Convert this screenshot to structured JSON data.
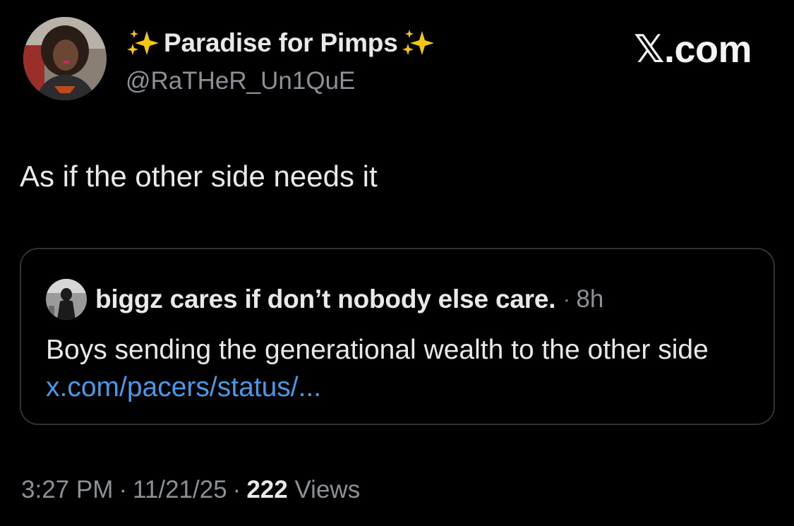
{
  "tweet": {
    "author": {
      "display_name": "Paradise for Pimps",
      "name_emoji": "sparkles-icon",
      "handle": "@RaTHeR_Un1QuE"
    },
    "brand": {
      "glyph": "𝕏",
      "suffix": ".com"
    },
    "text": "As if the other side needs it",
    "quoted": {
      "author_name": "biggz cares if don’t nobody else care.",
      "separator": "·",
      "time": "8h",
      "text": "Boys sending the generational wealth to the other side ",
      "link_text": "x.com/pacers/status/..."
    },
    "meta": {
      "time": "3:27 PM",
      "date": "11/21/25",
      "separator": "·",
      "views_count": "222",
      "views_label": "Views"
    }
  },
  "colors": {
    "background": "#000000",
    "text_primary": "#e7e9ea",
    "text_secondary": "#8b9197",
    "link": "#4a99e9",
    "border": "#2f3336",
    "sparkle": "#f5c518"
  }
}
